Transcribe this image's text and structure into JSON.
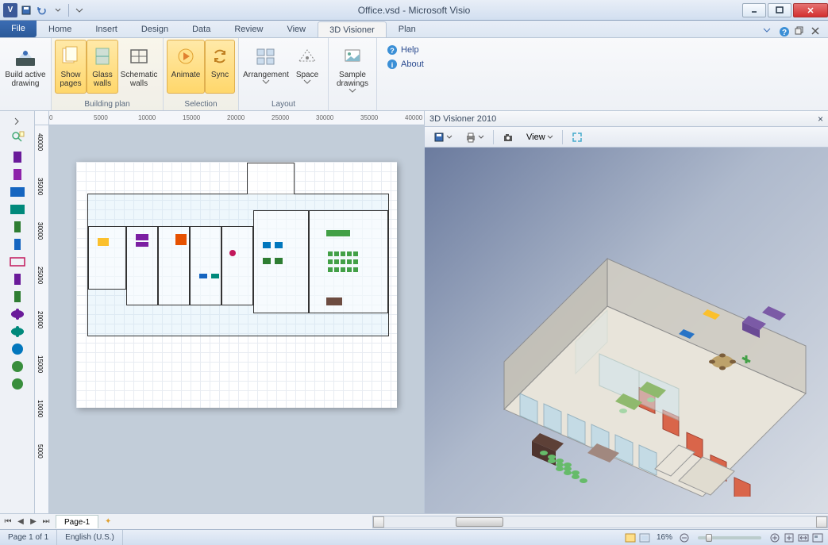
{
  "title": "Office.vsd - Microsoft Visio",
  "app_letter": "V",
  "menu": {
    "file": "File",
    "tabs": [
      "Home",
      "Insert",
      "Design",
      "Data",
      "Review",
      "View",
      "3D Visioner",
      "Plan"
    ],
    "active_tab_index": 6
  },
  "ribbon": {
    "build": {
      "label": "Build active\ndrawing"
    },
    "building_plan": {
      "group_label": "Building plan",
      "show_pages": "Show\npages",
      "glass_walls": "Glass\nwalls",
      "schematic_walls": "Schematic\nwalls"
    },
    "selection": {
      "group_label": "Selection",
      "animate": "Animate",
      "sync": "Sync"
    },
    "layout": {
      "group_label": "Layout",
      "arrangement": "Arrangement",
      "space": "Space"
    },
    "sample": {
      "label": "Sample\ndrawings"
    },
    "help": {
      "help": "Help",
      "about": "About"
    }
  },
  "ruler_h": [
    "0",
    "5000",
    "10000",
    "15000",
    "20000",
    "25000",
    "30000",
    "35000",
    "40000"
  ],
  "ruler_v": [
    "40000",
    "35000",
    "30000",
    "25000",
    "20000",
    "15000",
    "10000",
    "5000"
  ],
  "sheet": {
    "page_tab": "Page-1"
  },
  "panel3d": {
    "title": "3D Visioner 2010",
    "view_btn": "View"
  },
  "status": {
    "page_of": "Page 1 of 1",
    "language": "English (U.S.)",
    "zoom": "16%"
  },
  "colors": {
    "accent": "#3b6db5",
    "ribbon_highlight": "#ffd76b",
    "canvas_bg": "#c2cdd9"
  },
  "stencil_shapes": [
    {
      "name": "stencil-shape-a",
      "fill": "#6a1b9a",
      "w": 10,
      "h": 14
    },
    {
      "name": "stencil-shape-b",
      "fill": "#8e24aa",
      "w": 10,
      "h": 14
    },
    {
      "name": "stencil-table-1",
      "fill": "#1565c0",
      "w": 18,
      "h": 12
    },
    {
      "name": "stencil-table-2",
      "fill": "#00897b",
      "w": 18,
      "h": 12
    },
    {
      "name": "stencil-block-a",
      "fill": "#2e7d32",
      "w": 8,
      "h": 14
    },
    {
      "name": "stencil-block-b",
      "fill": "#1565c0",
      "w": 8,
      "h": 14
    },
    {
      "name": "stencil-sofa",
      "fill": "#c2185b",
      "w": 18,
      "h": 10,
      "strokeOnly": true
    },
    {
      "name": "stencil-block-c",
      "fill": "#6a1b9a",
      "w": 8,
      "h": 14
    },
    {
      "name": "stencil-block-d",
      "fill": "#2e7d32",
      "w": 8,
      "h": 14
    },
    {
      "name": "stencil-round-a",
      "fill": "#6a1b9a",
      "w": 16,
      "h": 14,
      "round": true
    },
    {
      "name": "stencil-round-b",
      "fill": "#00897b",
      "w": 16,
      "h": 14,
      "round": true
    },
    {
      "name": "stencil-circle-a",
      "fill": "#0277bd",
      "w": 14,
      "h": 14,
      "circle": true
    },
    {
      "name": "stencil-circle-b",
      "fill": "#388e3c",
      "w": 14,
      "h": 14,
      "circle": true
    },
    {
      "name": "stencil-circle-c",
      "fill": "#388e3c",
      "w": 14,
      "h": 14,
      "circle": true
    }
  ]
}
